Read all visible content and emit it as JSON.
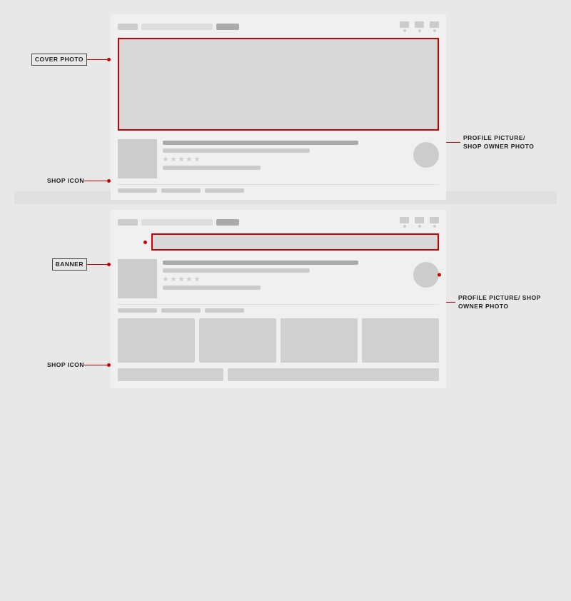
{
  "sections": [
    {
      "id": "cover-photo-section",
      "annotations": {
        "left": {
          "label": "COVER PHOTO",
          "hasBox": true
        },
        "right": {
          "label": "PROFILE PICTURE/\nSHOP OWNER PHOTO",
          "hasBox": false
        },
        "bottomLeft": {
          "label": "SHOP ICON",
          "hasBox": false
        }
      }
    },
    {
      "id": "banner-section",
      "annotations": {
        "left": {
          "label": "BANNER",
          "hasBox": true
        },
        "right": {
          "label": "PROFILE PICTURE/\nSHOP OWNER PHOTO",
          "hasBox": false
        },
        "bottomLeft": {
          "label": "SHOP ICON",
          "hasBox": false
        }
      }
    }
  ],
  "colors": {
    "red": "#cc0000",
    "light_gray": "#d8d8d8",
    "medium_gray": "#ccc",
    "dark_gray": "#aaa",
    "bg": "#e8e8e8"
  }
}
